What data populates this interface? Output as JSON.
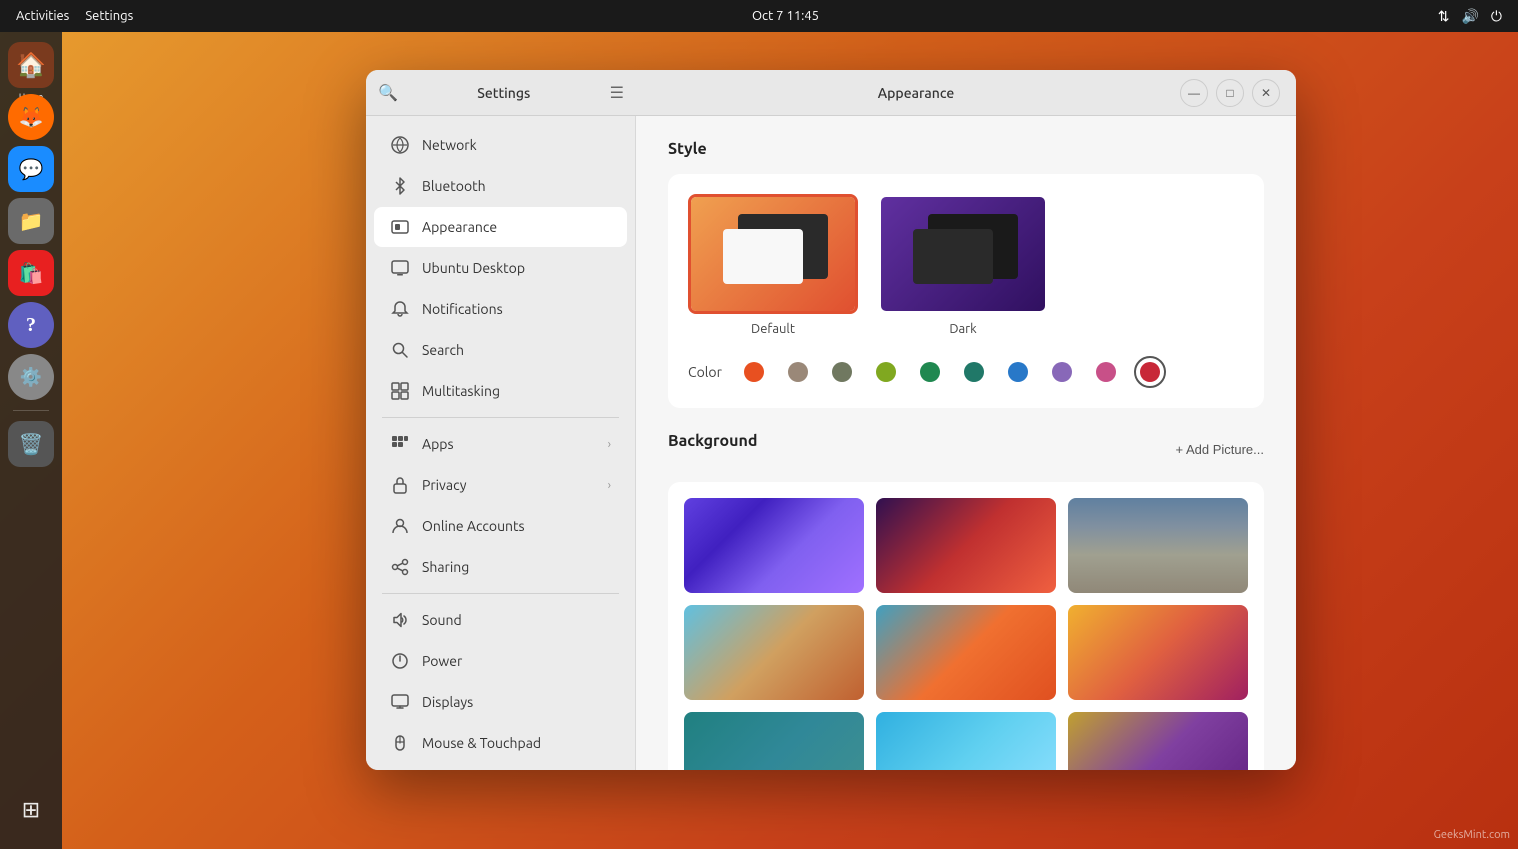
{
  "topbar": {
    "activities": "Activities",
    "settings": "Settings",
    "datetime": "Oct 7  11:45",
    "network_icon": "⇅",
    "sound_icon": "🔊",
    "power_icon": "⏻"
  },
  "dock": {
    "items": [
      {
        "name": "home",
        "label": "Home",
        "icon": "🏠"
      },
      {
        "name": "firefox",
        "label": "",
        "icon": "🦊"
      },
      {
        "name": "chat",
        "label": "",
        "icon": "💬"
      },
      {
        "name": "files",
        "label": "",
        "icon": "📁"
      },
      {
        "name": "appstore",
        "label": "",
        "icon": "🛍️"
      },
      {
        "name": "help",
        "label": "",
        "icon": "❓"
      },
      {
        "name": "settings",
        "label": "",
        "icon": "⚙️"
      },
      {
        "name": "trash",
        "label": "",
        "icon": "🗑️"
      }
    ],
    "appgrid_icon": "⊞"
  },
  "window": {
    "title_left": "Settings",
    "title_right": "Appearance",
    "controls": {
      "minimize": "—",
      "maximize": "□",
      "close": "✕"
    }
  },
  "sidebar": {
    "search_placeholder": "Search",
    "items": [
      {
        "id": "network",
        "label": "Network",
        "icon": "network",
        "has_arrow": false
      },
      {
        "id": "bluetooth",
        "label": "Bluetooth",
        "icon": "bluetooth",
        "has_arrow": false
      },
      {
        "id": "appearance",
        "label": "Appearance",
        "icon": "appearance",
        "active": true,
        "has_arrow": false
      },
      {
        "id": "ubuntu-desktop",
        "label": "Ubuntu Desktop",
        "icon": "ubuntu",
        "has_arrow": false
      },
      {
        "id": "notifications",
        "label": "Notifications",
        "icon": "notifications",
        "has_arrow": false
      },
      {
        "id": "search",
        "label": "Search",
        "icon": "search",
        "has_arrow": false
      },
      {
        "id": "multitasking",
        "label": "Multitasking",
        "icon": "multitasking",
        "has_arrow": false
      },
      {
        "id": "apps",
        "label": "Apps",
        "icon": "apps",
        "has_arrow": true
      },
      {
        "id": "privacy",
        "label": "Privacy",
        "icon": "privacy",
        "has_arrow": true
      },
      {
        "id": "online-accounts",
        "label": "Online Accounts",
        "icon": "online-accounts",
        "has_arrow": false
      },
      {
        "id": "sharing",
        "label": "Sharing",
        "icon": "sharing",
        "has_arrow": false
      },
      {
        "id": "sound",
        "label": "Sound",
        "icon": "sound",
        "has_arrow": false
      },
      {
        "id": "power",
        "label": "Power",
        "icon": "power",
        "has_arrow": false
      },
      {
        "id": "displays",
        "label": "Displays",
        "icon": "displays",
        "has_arrow": false
      },
      {
        "id": "mouse-touchpad",
        "label": "Mouse & Touchpad",
        "icon": "mouse",
        "has_arrow": false
      }
    ]
  },
  "appearance": {
    "style_section_title": "Style",
    "style_options": [
      {
        "id": "default",
        "label": "Default",
        "selected": true
      },
      {
        "id": "dark",
        "label": "Dark",
        "selected": false
      }
    ],
    "color_label": "Color",
    "colors": [
      {
        "id": "orange",
        "hex": "#e85020",
        "selected": false
      },
      {
        "id": "tan",
        "hex": "#9a8878",
        "selected": false
      },
      {
        "id": "olive",
        "hex": "#707860",
        "selected": false
      },
      {
        "id": "green",
        "hex": "#80a820",
        "selected": false
      },
      {
        "id": "teal",
        "hex": "#208850",
        "selected": false
      },
      {
        "id": "dark-teal",
        "hex": "#207868",
        "selected": false
      },
      {
        "id": "blue",
        "hex": "#2878c8",
        "selected": false
      },
      {
        "id": "purple",
        "hex": "#8868b8",
        "selected": false
      },
      {
        "id": "pink",
        "hex": "#c85088",
        "selected": false
      },
      {
        "id": "red",
        "hex": "#c82838",
        "selected": true
      }
    ],
    "background_section_title": "Background",
    "add_picture_label": "+ Add Picture...",
    "wallpapers": [
      {
        "id": "wp1",
        "class": "bg1"
      },
      {
        "id": "wp2",
        "class": "bg2"
      },
      {
        "id": "wp3",
        "class": "bg-mountains"
      },
      {
        "id": "wp4",
        "class": "bg4"
      },
      {
        "id": "wp5",
        "class": "bg5"
      },
      {
        "id": "wp6",
        "class": "bg6"
      },
      {
        "id": "wp7",
        "class": "bg7"
      },
      {
        "id": "wp8",
        "class": "bg8"
      },
      {
        "id": "wp9",
        "class": "bg9"
      }
    ]
  },
  "watermark": "GeeksMint.com"
}
